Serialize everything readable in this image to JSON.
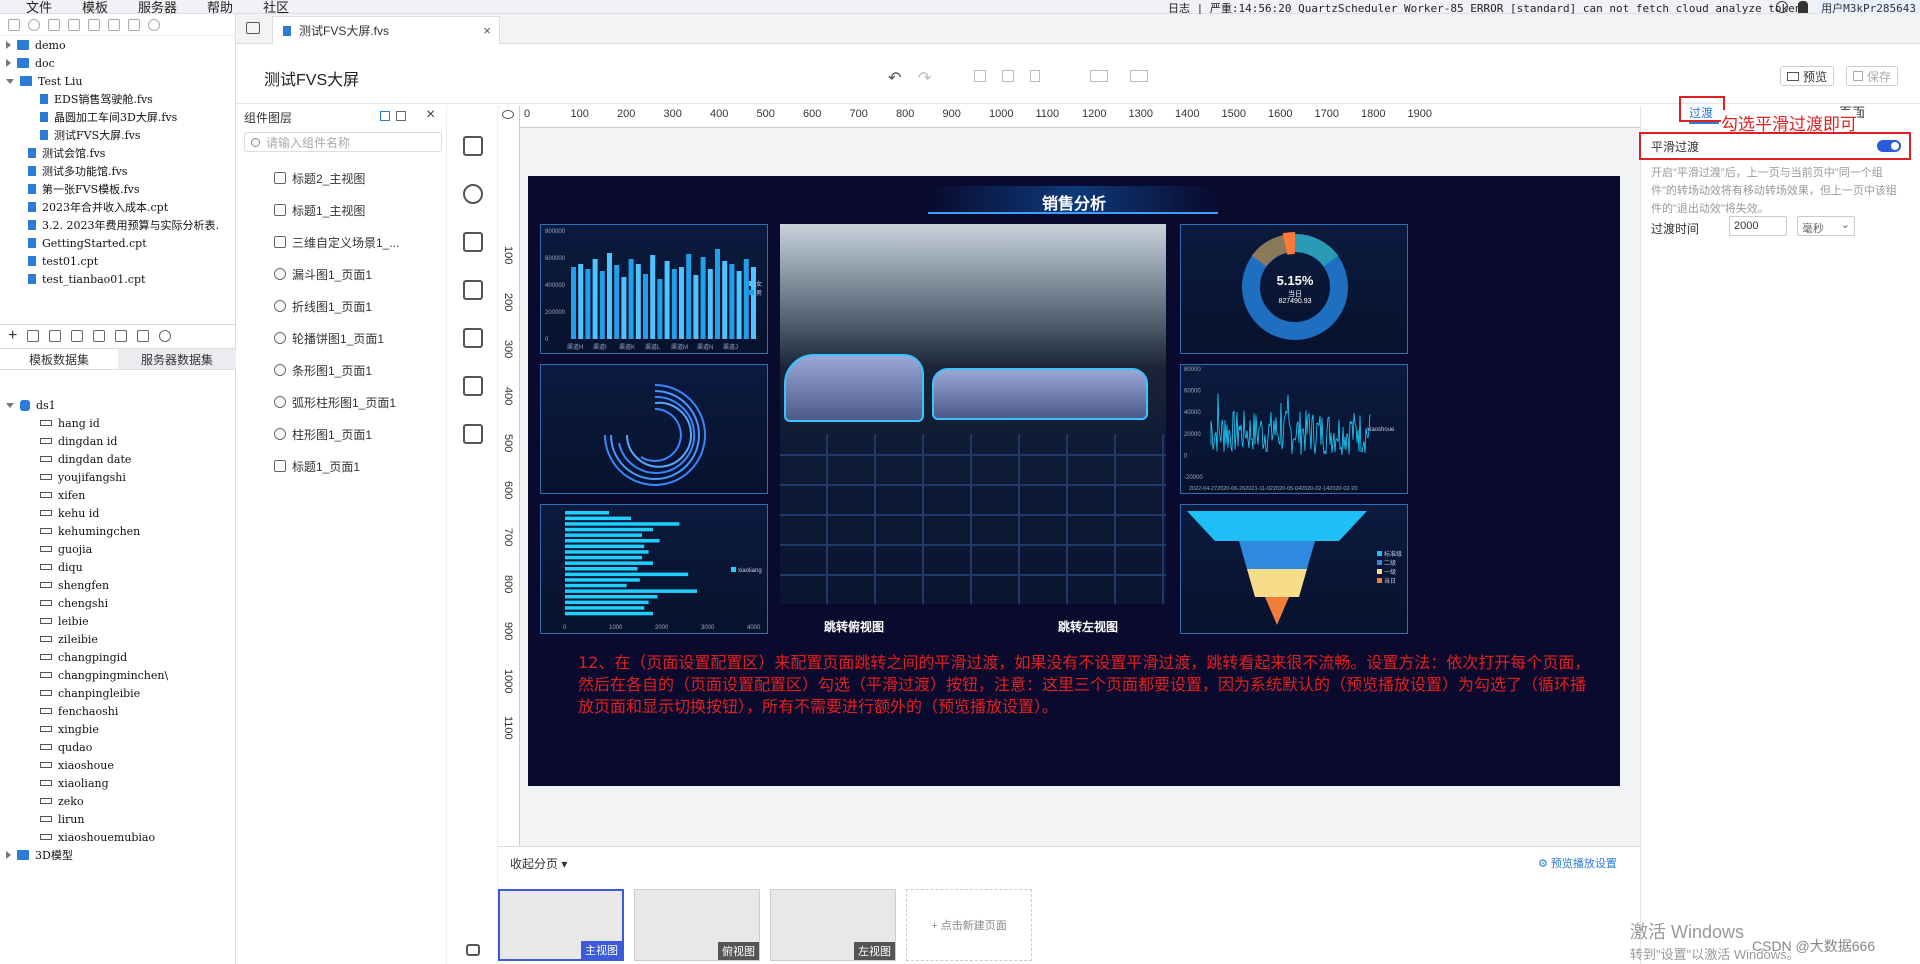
{
  "menubar": {
    "items": [
      "文件",
      "模板",
      "服务器",
      "帮助",
      "社区"
    ],
    "log_label": "日志",
    "log_text": "严重:14:56:20 QuartzScheduler_Worker-85 ERROR [standard] can not fetch cloud analyze token.",
    "user": "用户M3kPr285643"
  },
  "tree": {
    "items": [
      {
        "label": "demo",
        "type": "folder",
        "indent": 0
      },
      {
        "label": "doc",
        "type": "folder",
        "indent": 0
      },
      {
        "label": "Test Liu",
        "type": "folder",
        "indent": 0,
        "open": true
      },
      {
        "label": "EDS销售驾驶舱.fvs",
        "type": "file",
        "indent": 2
      },
      {
        "label": "晶圆加工车间3D大屏.fvs",
        "type": "file",
        "indent": 2
      },
      {
        "label": "测试FVS大屏.fvs",
        "type": "file",
        "indent": 2
      },
      {
        "label": "测试会馆.fvs",
        "type": "file",
        "indent": 1
      },
      {
        "label": "测试多功能馆.fvs",
        "type": "file",
        "indent": 1
      },
      {
        "label": "第一张FVS模板.fvs",
        "type": "file",
        "indent": 1
      },
      {
        "label": "2023年合并收入成本.cpt",
        "type": "file",
        "indent": 1
      },
      {
        "label": "3.2. 2023年费用预算与实际分析表.",
        "type": "file",
        "indent": 1
      },
      {
        "label": "GettingStarted.cpt",
        "type": "file",
        "indent": 1
      },
      {
        "label": "test01.cpt",
        "type": "file",
        "indent": 1
      },
      {
        "label": "test_tianbao01.cpt",
        "type": "file",
        "indent": 1
      }
    ]
  },
  "dataset_tabs": {
    "template": "模板数据集",
    "server": "服务器数据集"
  },
  "dataset": {
    "name": "ds1",
    "fields": [
      "hang id",
      "dingdan id",
      "dingdan date",
      "youjifangshi",
      "xifen",
      "kehu id",
      "kehumingchen",
      "guojia",
      "diqu",
      "shengfen",
      "chengshi",
      "leibie",
      "zileibie",
      "changpingid",
      "changpingminchen\\",
      "chanpingleibie",
      "fenchaoshi",
      "xingbie",
      "qudao",
      "xiaoshoue",
      "xiaoliang",
      "zeko",
      "lirun",
      "xiaoshouemubiao"
    ],
    "model": "3D模型"
  },
  "tab": {
    "label": "测试FVS大屏.fvs",
    "close": "×"
  },
  "editor": {
    "title": "测试FVS大屏",
    "preview": "预览",
    "save": "保存"
  },
  "layers": {
    "title": "组件图层",
    "search_placeholder": "请输入组件名称",
    "items": [
      {
        "label": "标题2_主视图",
        "icon": "text"
      },
      {
        "label": "标题1_主视图",
        "icon": "text"
      },
      {
        "label": "三维自定义场景1_...",
        "icon": "cube"
      },
      {
        "label": "漏斗图1_页面1",
        "icon": "chart"
      },
      {
        "label": "折线图1_页面1",
        "icon": "chart"
      },
      {
        "label": "轮播饼图1_页面1",
        "icon": "chart"
      },
      {
        "label": "条形图1_页面1",
        "icon": "chart"
      },
      {
        "label": "弧形柱形图1_页面1",
        "icon": "chart"
      },
      {
        "label": "柱形图1_页面1",
        "icon": "chart"
      },
      {
        "label": "标题1_页面1",
        "icon": "text"
      }
    ]
  },
  "ruler": {
    "h": [
      "0",
      "100",
      "200",
      "300",
      "400",
      "500",
      "600",
      "700",
      "800",
      "900",
      "1000",
      "1100",
      "1200",
      "1300",
      "1400",
      "1500",
      "1600",
      "1700",
      "1800",
      "1900"
    ],
    "v": [
      "100",
      "200",
      "300",
      "400",
      "500",
      "600",
      "700",
      "800",
      "900",
      "1000",
      "1100"
    ]
  },
  "screen": {
    "title": "销售分析",
    "btn_bird": "跳转俯视图",
    "btn_left": "跳转左视图",
    "donut_pct": "5.15%",
    "donut_sub": "当日",
    "donut_val": "827490.93",
    "legend_gender": [
      "女",
      "男"
    ],
    "bar_cats": [
      "渠道H",
      "渠道I",
      "渠道K",
      "渠道L",
      "渠道M",
      "渠道N",
      "渠道J"
    ],
    "bar_yticks": [
      "800000",
      "600000",
      "400000",
      "200000",
      "0"
    ],
    "line_yticks": [
      "80000",
      "60000",
      "40000",
      "20000",
      "0",
      "-20000"
    ],
    "line_legend": "xiaoshoue",
    "line_xticks": "2022-04-272020-06-262021-11-022020-05-042020-02-142020-02-20",
    "hbar_legend": "xiaoliang",
    "hbar_xticks": [
      "0",
      "1000",
      "2000",
      "3000",
      "4000"
    ],
    "funnel_legend": [
      "标准级",
      "二级",
      "一级",
      "当日"
    ]
  },
  "right": {
    "tab_transition": "过渡",
    "tab_page": "页面",
    "smooth_label": "平滑过渡",
    "smooth_on": true,
    "desc": "开启\"平滑过渡\"后，上一页与当前页中\"同一个组件\"的转场动效将有移动转场效果，但上一页中该组件的\"退出动效\"将失效。",
    "duration_label": "过渡时间",
    "duration_value": "2000",
    "duration_unit": "毫秒"
  },
  "annotation_top": "勾选平滑过渡即可",
  "annotation_main": "12、在（页面设置配置区）来配置页面跳转之间的平滑过渡，如果没有不设置平滑过渡，跳转看起来很不流畅。设置方法：依次打开每个页面，然后在各自的（页面设置配置区）勾选（平滑过渡）按钮，注意：这里三个页面都要设置，因为系统默认的（预览播放设置）为勾选了（循环播放页面和显示切换按钮），所有不需要进行额外的（预览播放设置）。",
  "bottom": {
    "collapse": "收起分页",
    "preview_settings": "预览播放设置",
    "pages": [
      "主视图",
      "俯视图",
      "左视图"
    ],
    "new_page": "+ 点击新建页面"
  },
  "watermark": {
    "line1": "激活 Windows",
    "line2": "转到\"设置\"以激活 Windows。",
    "csdn": "CSDN @大数据666"
  }
}
